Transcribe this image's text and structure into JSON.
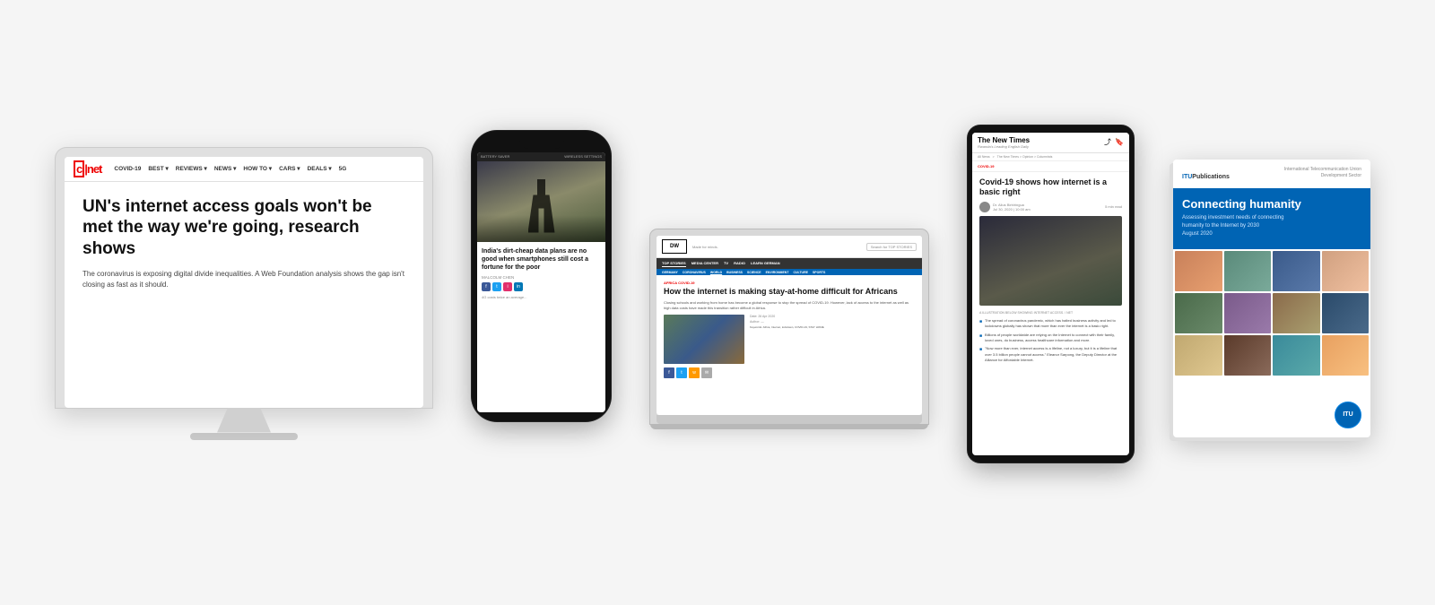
{
  "scene": {
    "bg_color": "#f5f5f5"
  },
  "cnet": {
    "logo": "c|net",
    "nav_items": [
      "COVID-19",
      "BEST ▾",
      "REVIEWS ▾",
      "NEWS ▾",
      "HOW TO ▾",
      "CARS ▾",
      "DEALS ▾",
      "5G"
    ],
    "headline": "UN's internet access goals won't be met the way we're going, research shows",
    "subtext": "The coronavirus is exposing digital divide inequalities. A Web Foundation analysis shows the gap isn't closing as fast as it should."
  },
  "phone": {
    "article_headline": "India's dirt-cheap data plans are no good when smartphones still cost a fortune for the poor",
    "nav_left": "BATTERY SAVER",
    "nav_right": "WIRELESS SETTINGS",
    "meta": "MALCOLM CHEN"
  },
  "dw": {
    "logo": "DW",
    "logo_sub": "Made for minds.",
    "nav_items": [
      "TOP STORIES",
      "MEDIA CENTER",
      "TV",
      "RADIO",
      "LEARN GERMAN"
    ],
    "sub_items": [
      "GERMANY",
      "CORONAVIRUS",
      "WORLD",
      "BUSINESS",
      "SCIENCE",
      "ENVIRONMENT",
      "CULTURE",
      "SPORTS"
    ],
    "label": "AFRICA COVID-19",
    "headline": "How the internet is making stay-at-home difficult for Africans",
    "subtext": "Closing schools and working from home has become a global response to stop the spread of COVID-19. However, lack of access to the internet as well as high data costs have made this transition rather difficult in Africa."
  },
  "new_times": {
    "logo": "The New Times",
    "tag": "COVID-19",
    "headline": "Covid-19 shows how internet is a basic right",
    "author": "Dr. Alius Birbiringua",
    "bullet_1": "The spread of coronavirus pandemic, which has halted business activity and led to lockdowns globally has shown that more than ever the internet is a basic right.",
    "bullet_2": "Billions of people worldwide are relying on the Internet to connect with their family, loved ones, do business, access healthcare information and more.",
    "bullet_3": "\"Now more than ever, internet access is a lifeline, not a luxury, but it is a lifeline that over 3.5 billion people cannot access.\" Eleanor Sarpong, the Deputy Director at the Alliance for Affordable Internet."
  },
  "itu": {
    "publisher": "ITU Publications",
    "org_line1": "International Telecommunication Union",
    "org_line2": "Development Sector",
    "title": "Connecting humanity",
    "subtitle_line1": "Assessing investment needs of connecting",
    "subtitle_line2": "humanity to the Internet by 2030",
    "subtitle_line3": "August 2020",
    "badge": "ITU"
  }
}
